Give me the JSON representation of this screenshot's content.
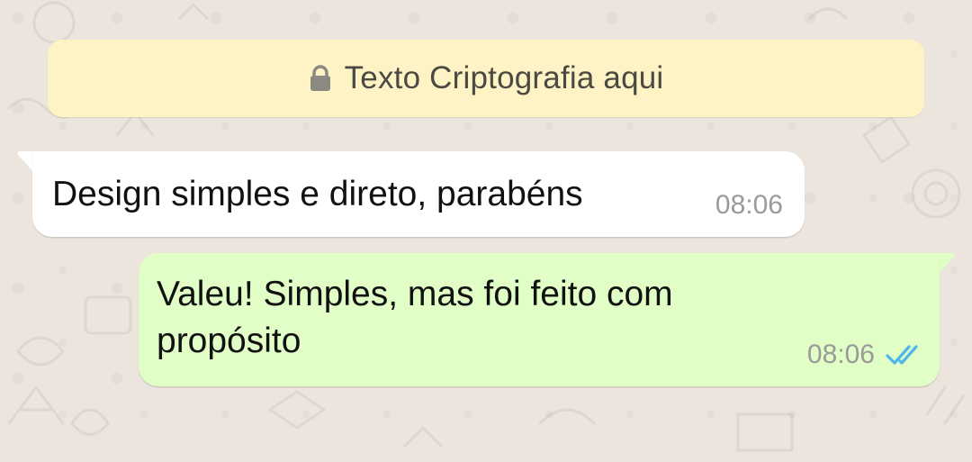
{
  "banner": {
    "text": "Texto Criptografia aqui",
    "icon": "lock-icon",
    "background": "#fdf3c5"
  },
  "messages": [
    {
      "direction": "incoming",
      "text": "Design simples e direto, parabéns",
      "time": "08:06",
      "background": "#ffffff"
    },
    {
      "direction": "outgoing",
      "text": "Valeu! Simples, mas foi feito com propósito",
      "time": "08:06",
      "status_icon": "double-check-icon",
      "status_color": "#4fb6ec",
      "background": "#e1fec6"
    }
  ]
}
